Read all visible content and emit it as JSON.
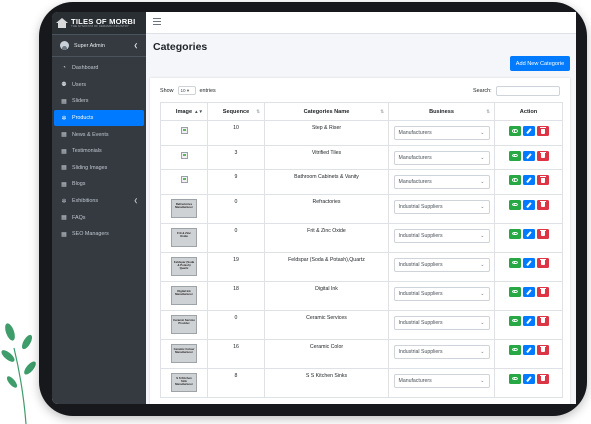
{
  "brand": {
    "name": "TILES OF MORBI",
    "tagline": "THE SYNONYM OF CERAMIC INDUSTRY"
  },
  "sidebar": {
    "user": "Super Admin",
    "items": [
      {
        "label": "Dashboard",
        "icon": "dashboard-icon",
        "glyph": "◔"
      },
      {
        "label": "Users",
        "icon": "users-icon",
        "glyph": "⚉"
      },
      {
        "label": "Sliders",
        "icon": "sliders-icon",
        "glyph": "▦"
      },
      {
        "label": "Products",
        "icon": "products-icon",
        "glyph": "✲",
        "active": true
      },
      {
        "label": "News & Events",
        "icon": "news-icon",
        "glyph": "▦"
      },
      {
        "label": "Testimonials",
        "icon": "testimonials-icon",
        "glyph": "▦"
      },
      {
        "label": "Sliding Images",
        "icon": "sliding-images-icon",
        "glyph": "▦"
      },
      {
        "label": "Blogs",
        "icon": "blogs-icon",
        "glyph": "▦"
      },
      {
        "label": "Exhibitions",
        "icon": "exhibitions-icon",
        "glyph": "✲",
        "caret": true
      },
      {
        "label": "FAQs",
        "icon": "faqs-icon",
        "glyph": "▦"
      },
      {
        "label": "SEO Managers",
        "icon": "seo-icon",
        "glyph": "▦"
      }
    ]
  },
  "page": {
    "title": "Categories",
    "add_button": "Add New Categorie"
  },
  "table_controls": {
    "show_label": "Show",
    "entries_value": "10",
    "entries_label": "entries",
    "search_label": "Search:"
  },
  "table": {
    "headers": [
      "Image",
      "Sequence",
      "Categories Name",
      "Business",
      "Action"
    ],
    "rows": [
      {
        "image": null,
        "sequence": "10",
        "name": "Step & Riser",
        "business": "Manufacturers"
      },
      {
        "image": null,
        "sequence": "3",
        "name": "Vitrified Tiles",
        "business": "Manufacturers"
      },
      {
        "image": null,
        "sequence": "9",
        "name": "Bathroom Cabinets & Vanity",
        "business": "Manufacturers"
      },
      {
        "image": "Refractories Manufacturer",
        "sequence": "0",
        "name": "Refractories",
        "business": "Industrial Suppliers"
      },
      {
        "image": "Frit & Zinc Oxide",
        "sequence": "0",
        "name": "Frit & Zinc Oxide",
        "business": "Industrial Suppliers"
      },
      {
        "image": "Feldspar (Soda & Potash) Quartz",
        "sequence": "19",
        "name": "Feldspar (Soda & Potash),Quartz",
        "business": "Industrial Suppliers"
      },
      {
        "image": "Digital Ink Manufacturer",
        "sequence": "18",
        "name": "Digital Ink",
        "business": "Industrial Suppliers"
      },
      {
        "image": "Ceramic Service Provider",
        "sequence": "0",
        "name": "Ceramic Services",
        "business": "Industrial Suppliers"
      },
      {
        "image": "Ceramic Colour Manufacturer",
        "sequence": "16",
        "name": "Ceramic Color",
        "business": "Industrial Suppliers"
      },
      {
        "image": "S S Kitchen Sink Manufacturer",
        "sequence": "8",
        "name": "S S Kitchen Sinks",
        "business": "Manufacturers"
      }
    ]
  }
}
